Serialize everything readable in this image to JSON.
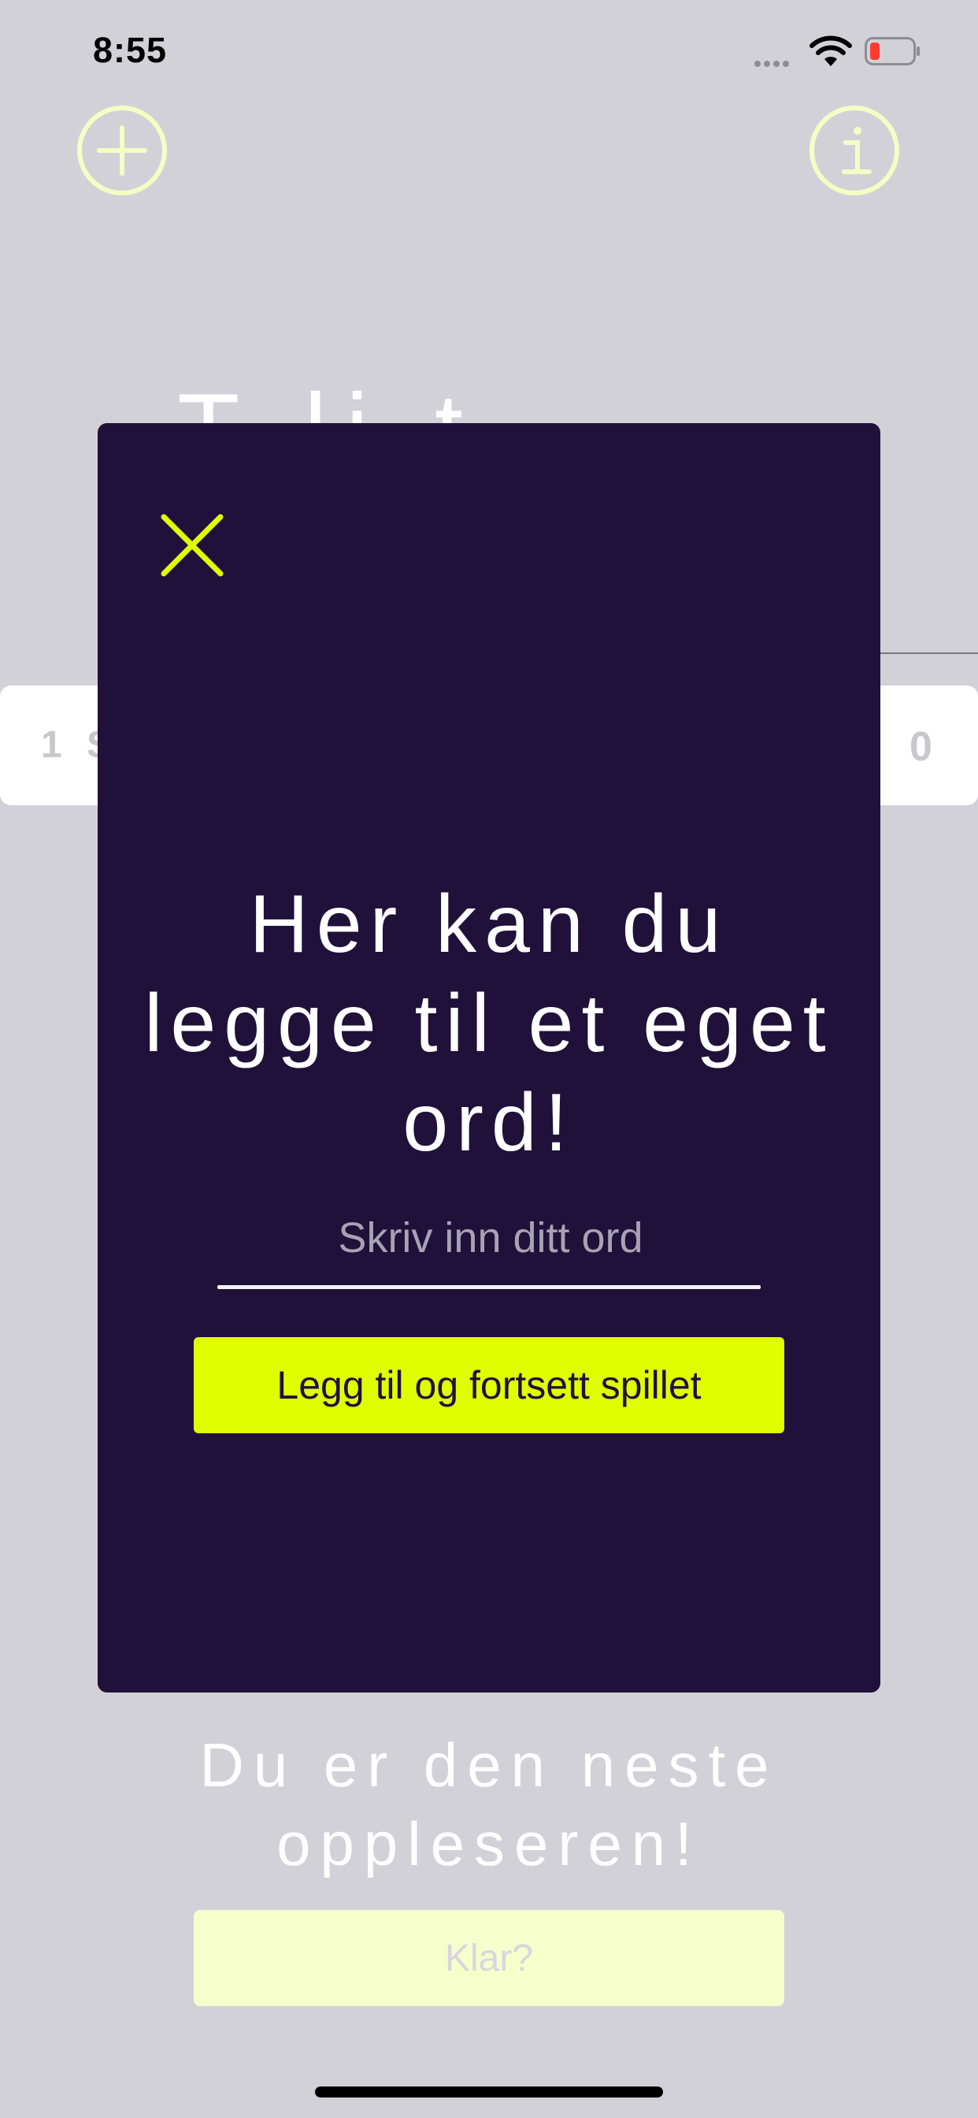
{
  "status_bar": {
    "time": "8:55"
  },
  "top_bar": {
    "add_icon": "plus-circle-icon",
    "info_icon": "info-circle-icon"
  },
  "background": {
    "title_partial": "T       li t",
    "score_row": {
      "rank": "1",
      "name_partial": "S",
      "score": "0"
    },
    "next_reader_line1": "Du er den neste",
    "next_reader_line2": "oppleseren!",
    "ready_button": "Klar?"
  },
  "modal": {
    "close_icon": "close-icon",
    "title_line1": "Her kan du",
    "title_line2": "legge til et eget",
    "title_line3": "ord!",
    "input_placeholder": "Skriv inn ditt ord",
    "input_value": "",
    "submit_button": "Legg til og fortsett spillet"
  },
  "colors": {
    "background": "#d3d1d8",
    "modal": "#20113a",
    "accent": "#e1fe00",
    "accent_pale": "#f4fec4"
  }
}
